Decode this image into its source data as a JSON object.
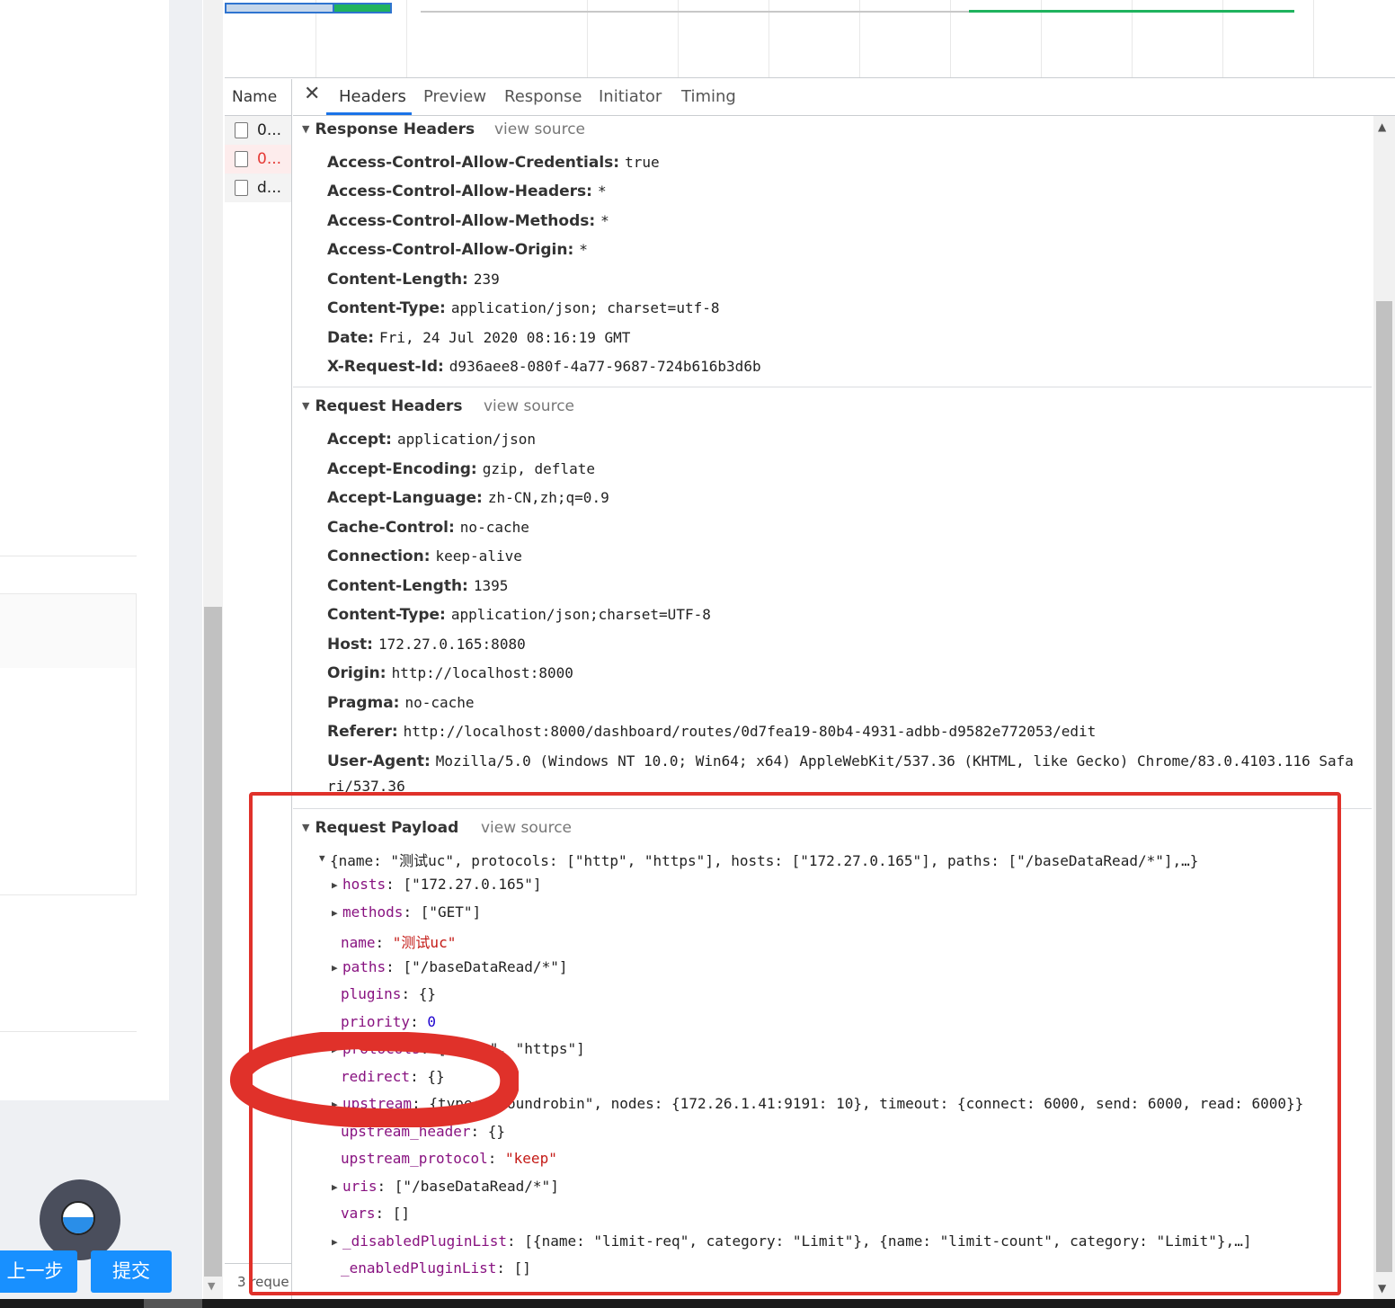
{
  "app": {
    "prev_label": "上一步",
    "submit_label": "提交"
  },
  "devtools": {
    "name_header": "Name",
    "requests": [
      "0...",
      "0...",
      "d..."
    ],
    "status": "3 reque",
    "tabs": [
      "Headers",
      "Preview",
      "Response",
      "Initiator",
      "Timing"
    ],
    "active_tab": "Headers",
    "view_source": "view source",
    "response_headers": {
      "title": "Response Headers",
      "rows": [
        {
          "k": "Access-Control-Allow-Credentials:",
          "v": "true"
        },
        {
          "k": "Access-Control-Allow-Headers:",
          "v": "*"
        },
        {
          "k": "Access-Control-Allow-Methods:",
          "v": "*"
        },
        {
          "k": "Access-Control-Allow-Origin:",
          "v": "*"
        },
        {
          "k": "Content-Length:",
          "v": "239"
        },
        {
          "k": "Content-Type:",
          "v": "application/json; charset=utf-8"
        },
        {
          "k": "Date:",
          "v": "Fri, 24 Jul 2020 08:16:19 GMT"
        },
        {
          "k": "X-Request-Id:",
          "v": "d936aee8-080f-4a77-9687-724b616b3d6b"
        }
      ]
    },
    "request_headers": {
      "title": "Request Headers",
      "rows": [
        {
          "k": "Accept:",
          "v": "application/json"
        },
        {
          "k": "Accept-Encoding:",
          "v": "gzip, deflate"
        },
        {
          "k": "Accept-Language:",
          "v": "zh-CN,zh;q=0.9"
        },
        {
          "k": "Cache-Control:",
          "v": "no-cache"
        },
        {
          "k": "Connection:",
          "v": "keep-alive"
        },
        {
          "k": "Content-Length:",
          "v": "1395"
        },
        {
          "k": "Content-Type:",
          "v": "application/json;charset=UTF-8"
        },
        {
          "k": "Host:",
          "v": "172.27.0.165:8080"
        },
        {
          "k": "Origin:",
          "v": "http://localhost:8000"
        },
        {
          "k": "Pragma:",
          "v": "no-cache"
        },
        {
          "k": "Referer:",
          "v": "http://localhost:8000/dashboard/routes/0d7fea19-80b4-4931-adbb-d9582e772053/edit"
        },
        {
          "k": "User-Agent:",
          "v": "Mozilla/5.0 (Windows NT 10.0; Win64; x64) AppleWebKit/537.36 (KHTML, like Gecko) Chrome/83.0.4103.116 Safa"
        }
      ],
      "wrap": "ri/537.36"
    },
    "payload": {
      "title": "Request Payload",
      "summary": "{name: \"测试uc\", protocols: [\"http\", \"https\"], hosts: [\"172.27.0.165\"], paths: [\"/baseDataRead/*\"],…}",
      "rows": [
        {
          "key": "hosts",
          "val": "[\"172.27.0.165\"]",
          "type": "plain",
          "expand": true
        },
        {
          "key": "methods",
          "val": "[\"GET\"]",
          "type": "plain",
          "expand": true
        },
        {
          "key": "name",
          "val": "\"测试uc\"",
          "type": "string",
          "expand": false
        },
        {
          "key": "paths",
          "val": "[\"/baseDataRead/*\"]",
          "type": "plain",
          "expand": true
        },
        {
          "key": "plugins",
          "val": "{}",
          "type": "plain",
          "expand": false
        },
        {
          "key": "priority",
          "val": "0",
          "type": "number",
          "expand": false
        },
        {
          "key": "protocols",
          "val": "[\"http\", \"https\"]",
          "type": "plain",
          "expand": true
        },
        {
          "key": "redirect",
          "val": "{}",
          "type": "plain",
          "expand": false
        },
        {
          "key": "upstream",
          "val": "{type: \"roundrobin\", nodes: {172.26.1.41:9191: 10}, timeout: {connect: 6000, send: 6000, read: 6000}}",
          "type": "plain",
          "expand": true
        },
        {
          "key": "upstream_header",
          "val": "{}",
          "type": "plain",
          "expand": false
        },
        {
          "key": "upstream_protocol",
          "val": "\"keep\"",
          "type": "string",
          "expand": false
        },
        {
          "key": "uris",
          "val": "[\"/baseDataRead/*\"]",
          "type": "plain",
          "expand": true
        },
        {
          "key": "vars",
          "val": "[]",
          "type": "plain",
          "expand": false
        },
        {
          "key": "_disabledPluginList",
          "val": "[{name: \"limit-req\", category: \"Limit\"}, {name: \"limit-count\", category: \"Limit\"},…]",
          "type": "plain",
          "expand": true
        },
        {
          "key": "_enabledPluginList",
          "val": "[]",
          "type": "plain",
          "expand": false
        }
      ]
    }
  },
  "colors": {
    "annotation": "#e0312a",
    "accent": "#1a73e8",
    "key": "#881280",
    "string": "#c41a16",
    "number": "#1c00cf"
  }
}
